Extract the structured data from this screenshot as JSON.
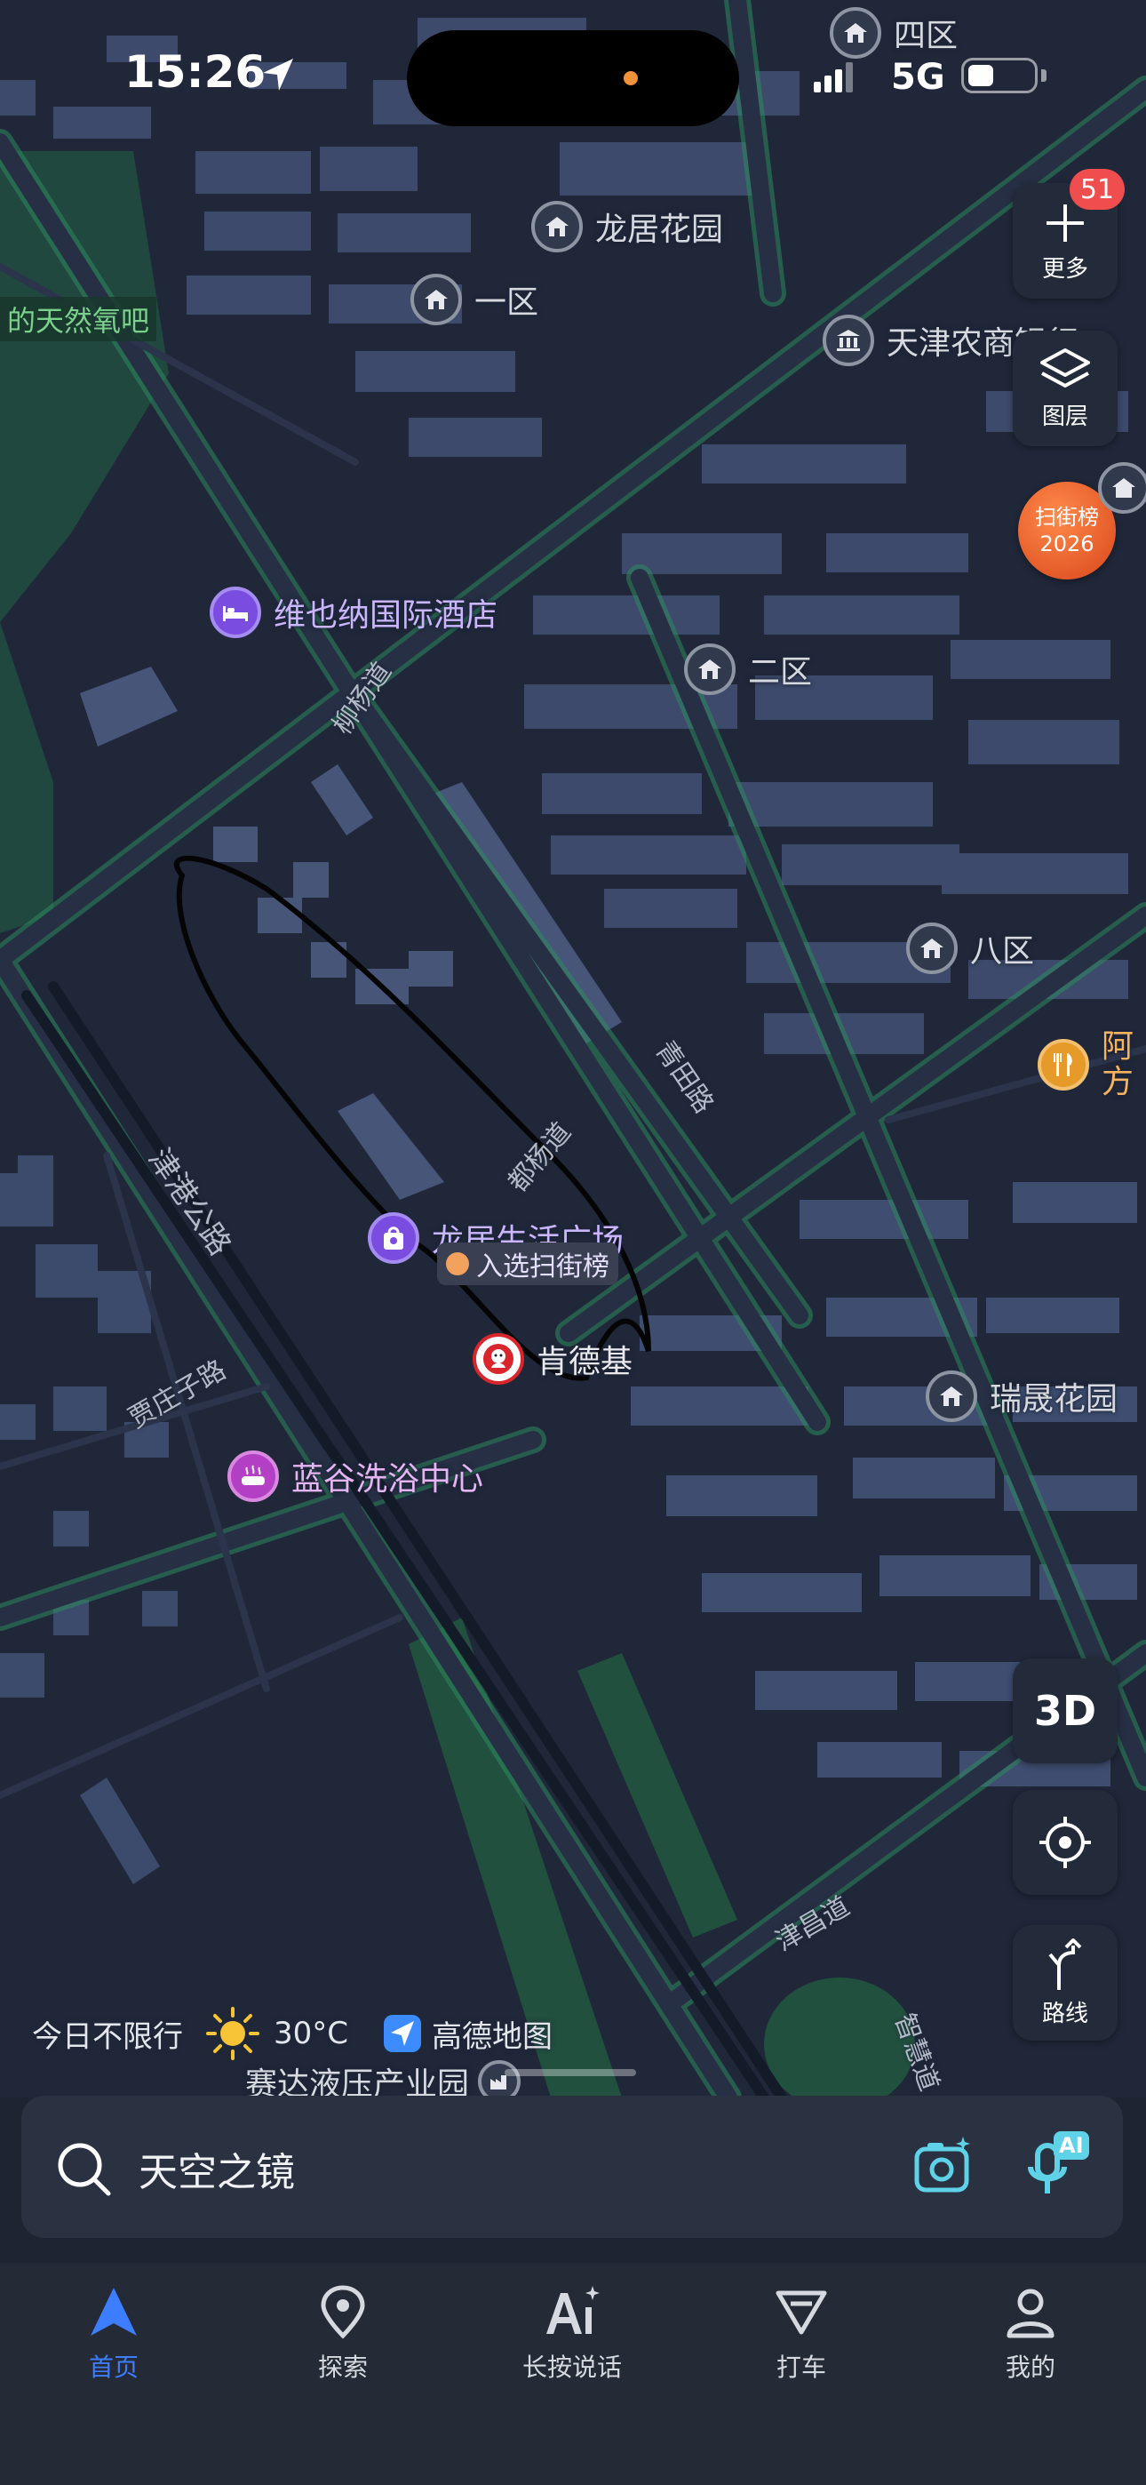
{
  "status_bar": {
    "time": "15:26",
    "network": "5G"
  },
  "map": {
    "pois": [
      {
        "label": "四区",
        "kind": "residential"
      },
      {
        "label": "龙居花园",
        "kind": "residential"
      },
      {
        "label": "一区",
        "kind": "residential"
      },
      {
        "label": "天津农商银行",
        "kind": "bank"
      },
      {
        "label": "维也纳国际酒店",
        "kind": "hotel"
      },
      {
        "label": "二区",
        "kind": "residential"
      },
      {
        "label": "八区",
        "kind": "residential"
      },
      {
        "label": "阿方东北",
        "kind": "restaurant"
      },
      {
        "label": "龙居生活广场",
        "kind": "shopping",
        "tag": "入选扫街榜"
      },
      {
        "label": "肯德基",
        "kind": "kfc"
      },
      {
        "label": "瑞晟花园",
        "kind": "residential"
      },
      {
        "label": "蓝谷洗浴中心",
        "kind": "bath"
      },
      {
        "label": "赛达液压产业园",
        "kind": "industrial"
      }
    ],
    "green_label": "的天然氧吧",
    "roads": [
      "柳杨道",
      "青田路",
      "都杨道",
      "津港公路",
      "贾庄子路",
      "津昌道",
      "智慧道"
    ]
  },
  "controls": {
    "more_label": "更多",
    "more_badge": "51",
    "layers_label": "图层",
    "street_rank": {
      "line1": "扫街榜",
      "line2": "2026"
    },
    "three_d_label": "3D",
    "route_label": "路线"
  },
  "info_row": {
    "restriction": "今日不限行",
    "temperature": "30°C",
    "brand": "高德地图"
  },
  "search": {
    "placeholder": "天空之镜",
    "ai_badge": "AI"
  },
  "tabs": [
    {
      "label": "首页",
      "active": true
    },
    {
      "label": "探索",
      "active": false
    },
    {
      "label": "长按说话",
      "active": false
    },
    {
      "label": "打车",
      "active": false
    },
    {
      "label": "我的",
      "active": false
    }
  ],
  "colors": {
    "accent": "#3d7dff",
    "map_bg": "#1c2436",
    "road_glow": "#2e8a5e",
    "badge": "#f04e4e"
  }
}
